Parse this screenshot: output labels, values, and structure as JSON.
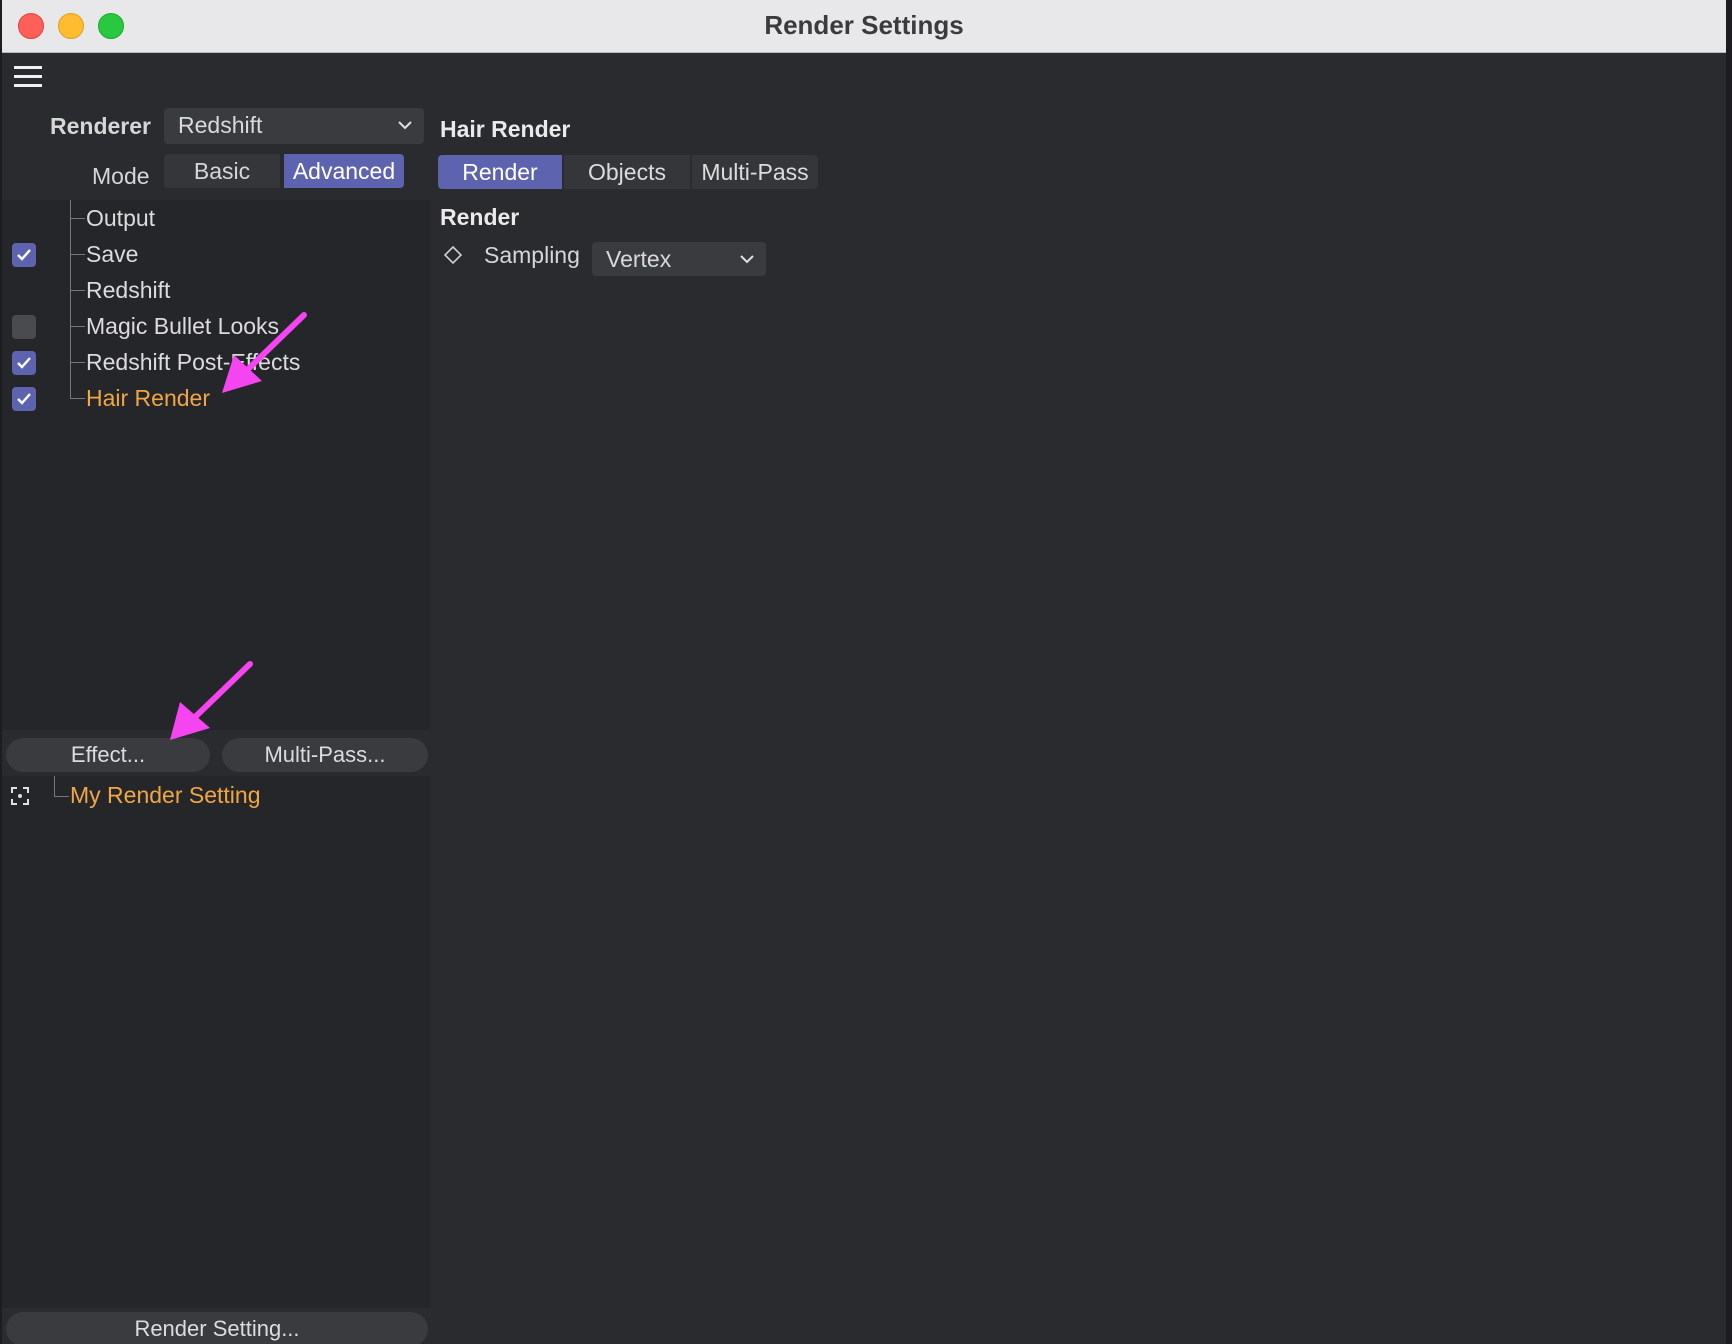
{
  "window": {
    "title": "Render Settings"
  },
  "renderer": {
    "label": "Renderer",
    "value": "Redshift"
  },
  "mode": {
    "label": "Mode",
    "options": [
      "Basic",
      "Advanced"
    ],
    "selected": "Advanced"
  },
  "tree": {
    "items": [
      {
        "label": "Output",
        "checkbox": null
      },
      {
        "label": "Save",
        "checkbox": true
      },
      {
        "label": "Redshift",
        "checkbox": null
      },
      {
        "label": "Magic Bullet Looks",
        "checkbox": false
      },
      {
        "label": "Redshift Post-Effects",
        "checkbox": true
      },
      {
        "label": "Hair Render",
        "checkbox": true,
        "active": true
      }
    ]
  },
  "buttons": {
    "effect": "Effect...",
    "multipass": "Multi-Pass...",
    "render_setting": "Render Setting..."
  },
  "settings_list": {
    "items": [
      {
        "label": "My Render Setting"
      }
    ]
  },
  "right": {
    "section_title": "Hair Render",
    "tabs": [
      "Render",
      "Objects",
      "Multi-Pass"
    ],
    "active_tab": "Render",
    "group_title": "Render",
    "sampling": {
      "label": "Sampling",
      "value": "Vertex"
    }
  },
  "colors": {
    "accent": "#5e63b0",
    "active_text": "#f0a642",
    "annotation_arrow": "#f545f0"
  }
}
